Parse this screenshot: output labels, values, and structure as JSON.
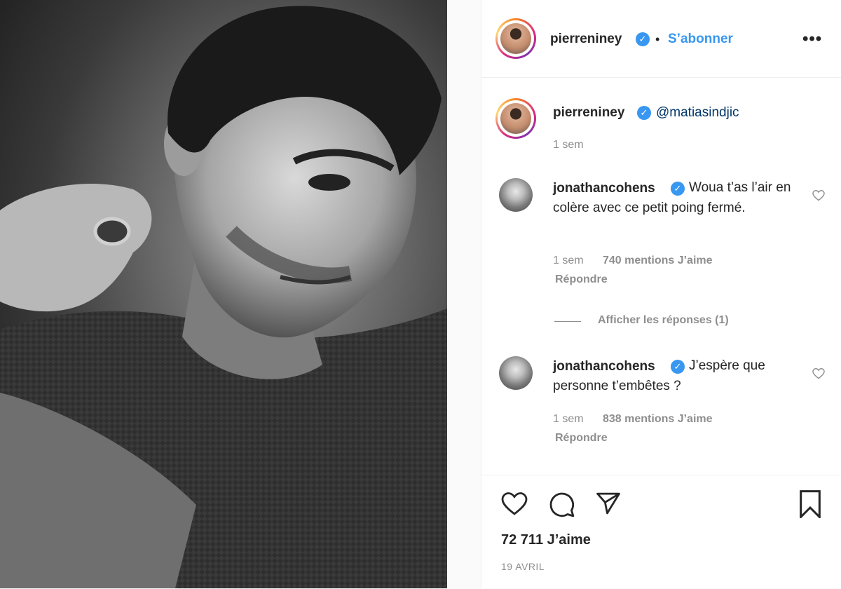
{
  "post": {
    "author": "pierreniney",
    "follow_label": "S’abonner",
    "separator": "•",
    "more_label": "•••",
    "caption": {
      "author": "pierreniney",
      "text": "@matiasindjic",
      "time": "1 sem"
    },
    "comments": [
      {
        "author": "jonathancohens",
        "text": "Woua t’as l’air en colère avec ce petit poing fermé.",
        "time": "1 sem",
        "likes": "740 mentions J’aime",
        "reply_label": "Répondre",
        "view_replies": "Afficher les réponses (1)"
      },
      {
        "author": "jonathancohens",
        "text": "J’espère que personne t’embêtes ?",
        "time": "1 sem",
        "likes": "838 mentions J’aime",
        "reply_label": "Répondre"
      }
    ],
    "likes_count": "72 711 J’aime",
    "date": "19 AVRIL",
    "colors": {
      "accent": "#3897f0",
      "mention": "#003569",
      "muted": "#8e8e8e"
    },
    "icons": [
      "heart-icon",
      "comment-icon",
      "share-icon",
      "bookmark-icon",
      "verified-badge-icon"
    ]
  }
}
